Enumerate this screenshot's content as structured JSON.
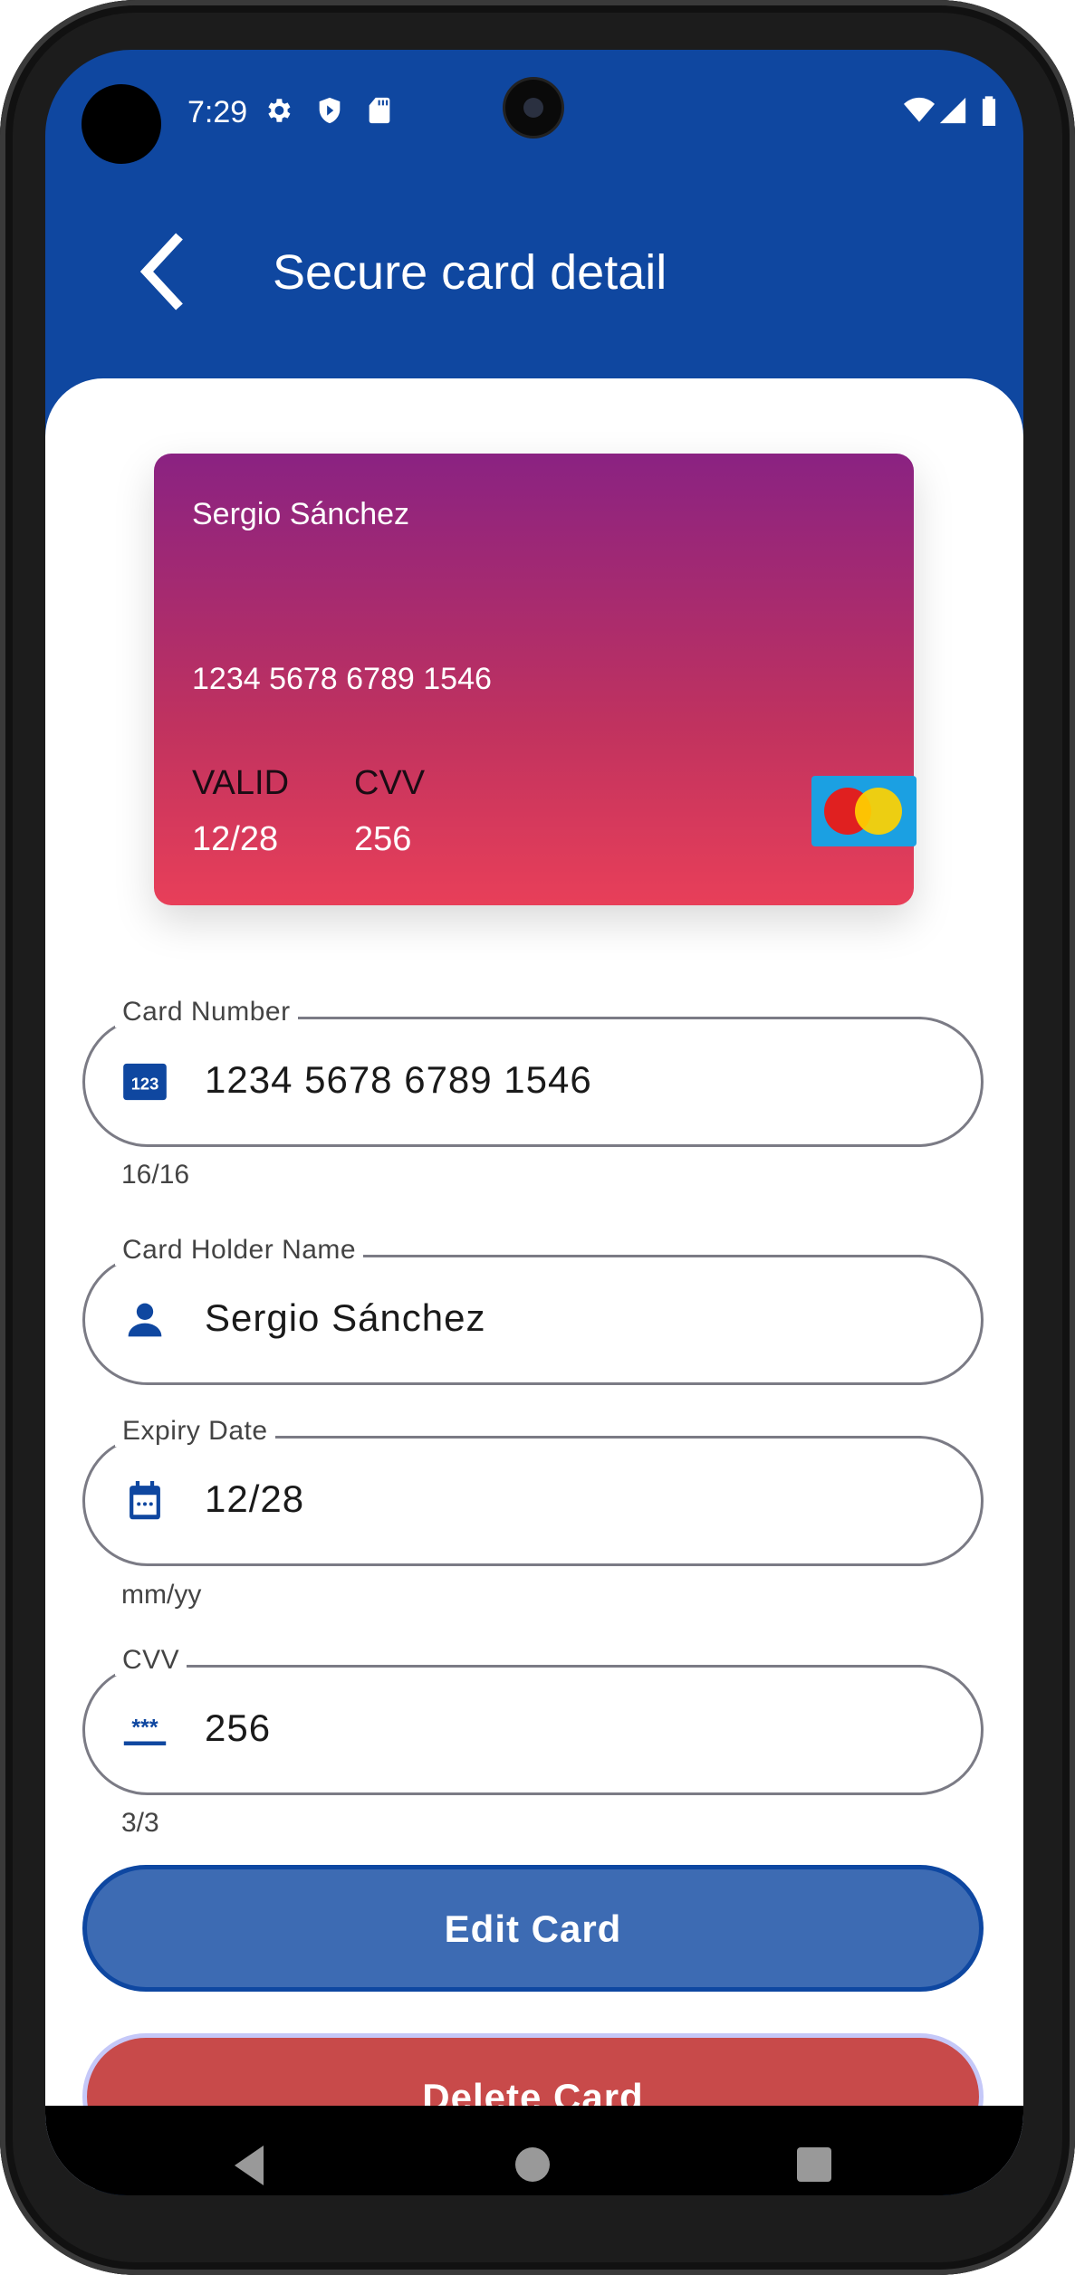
{
  "status_bar": {
    "time": "7:29",
    "icons": [
      "gear-icon",
      "shield-play-icon",
      "sd-card-icon",
      "wifi-icon",
      "signal-icon",
      "battery-icon"
    ]
  },
  "app_bar": {
    "title": "Secure card detail",
    "back_icon": "chevron-left-icon"
  },
  "card_preview": {
    "holder": "Sergio Sánchez",
    "number": "1234 5678 6789 1546",
    "valid_label": "VALID",
    "valid_value": "12/28",
    "cvv_label": "CVV",
    "cvv_value": "256",
    "brand": "mastercard",
    "gradient": [
      "#8A2282",
      "#E83F59"
    ]
  },
  "form": {
    "card_number": {
      "label": "Card Number",
      "value": "1234 5678 6789 1546",
      "helper": "16/16",
      "icon": "numbers-icon"
    },
    "holder_name": {
      "label": "Card Holder Name",
      "value": "Sergio Sánchez",
      "icon": "person-icon"
    },
    "expiry": {
      "label": "Expiry Date",
      "value": "12/28",
      "helper": "mm/yy",
      "icon": "calendar-icon"
    },
    "cvv": {
      "label": "CVV",
      "value": "256",
      "helper": "3/3",
      "icon": "password-icon"
    }
  },
  "buttons": {
    "edit": "Edit Card",
    "delete": "Delete Card"
  },
  "colors": {
    "primary": "#0F47A0",
    "edit_button": "#3D6BB3",
    "delete_button": "#C84A4A"
  }
}
